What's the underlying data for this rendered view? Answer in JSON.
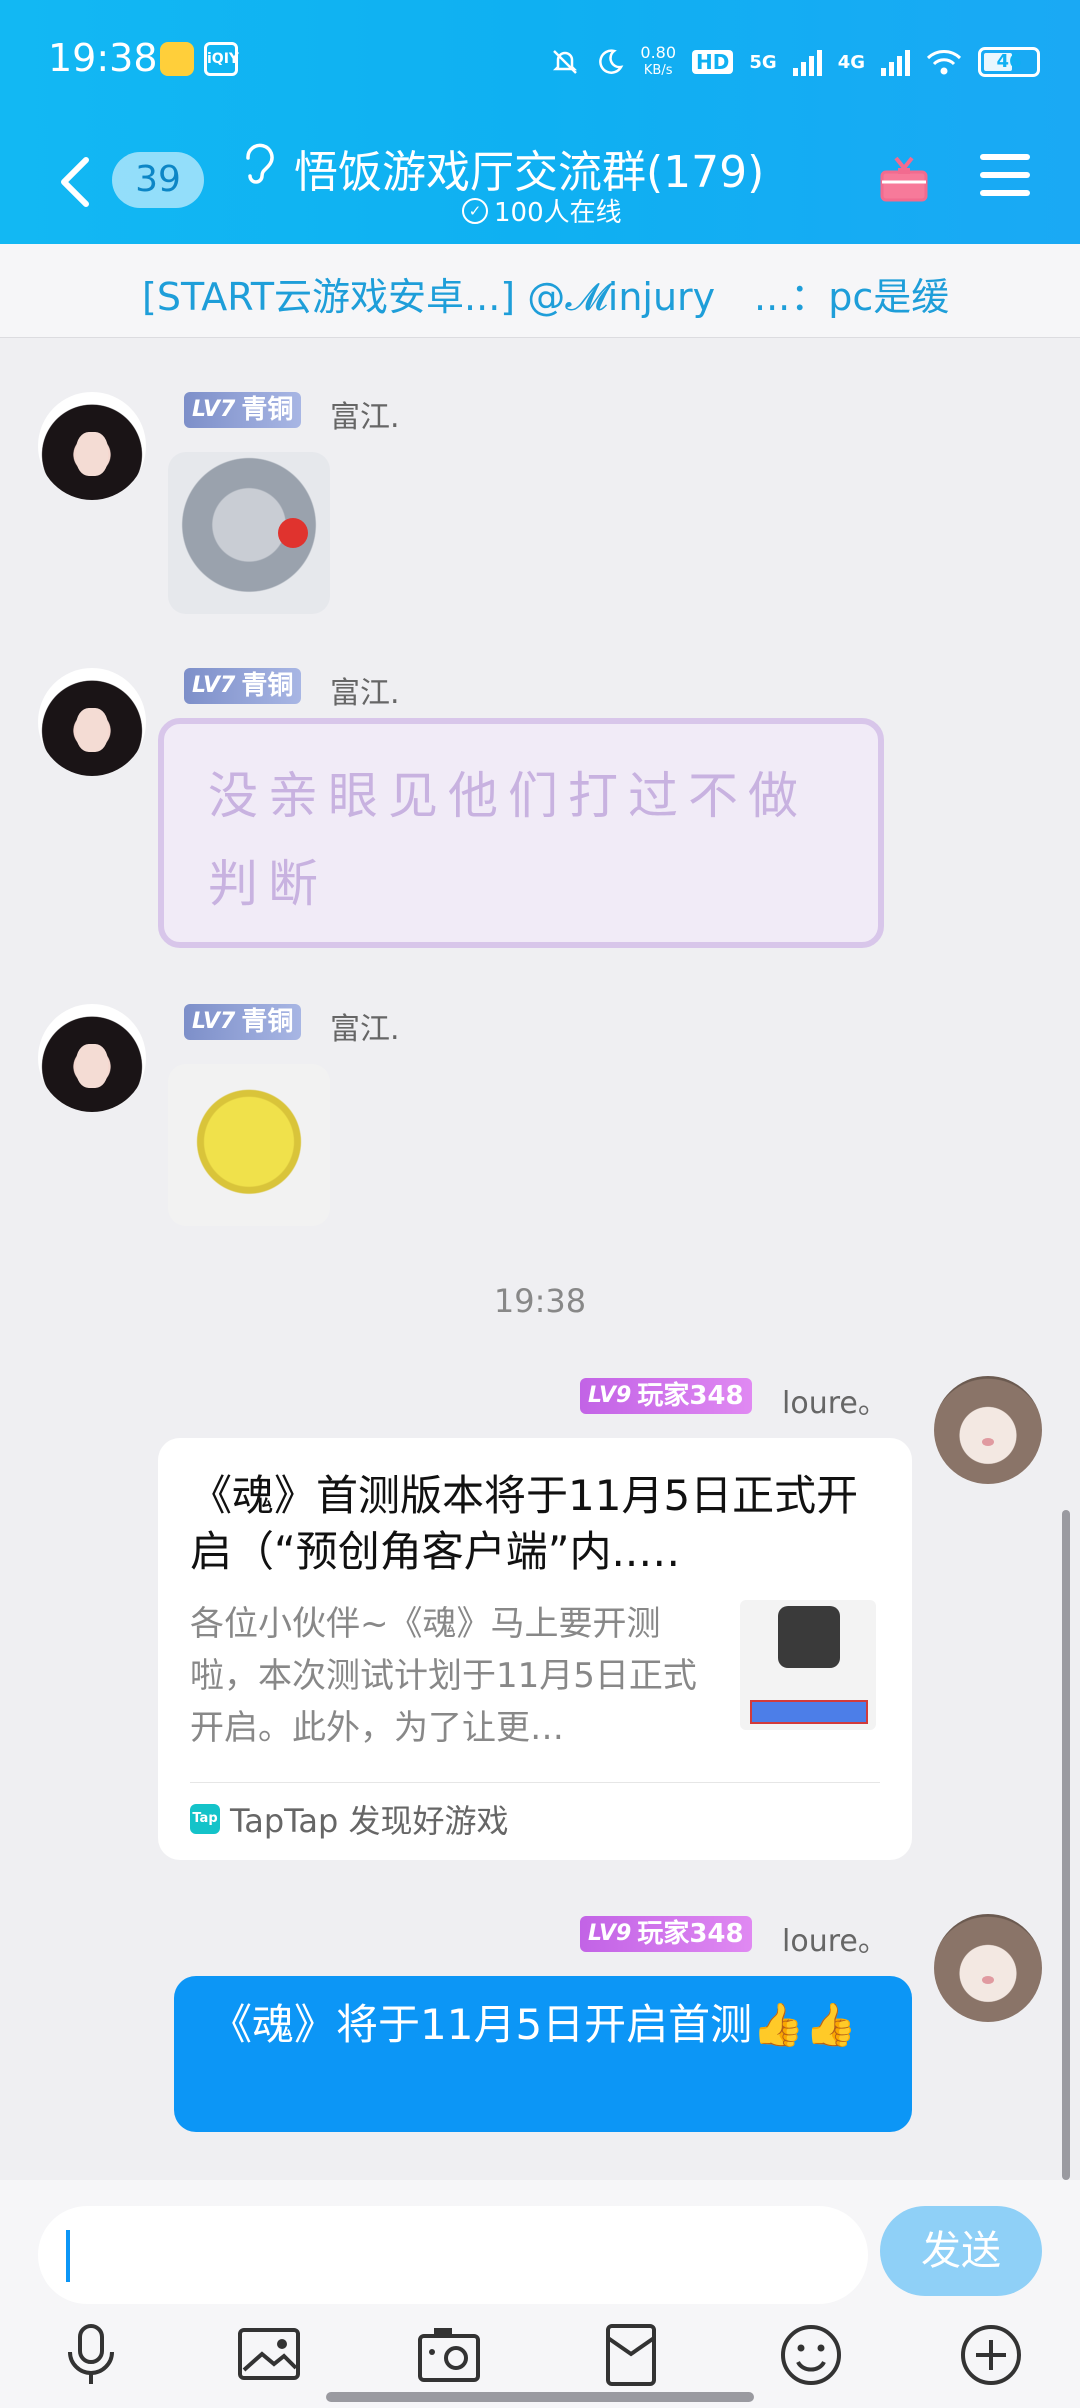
{
  "status_bar": {
    "time": "19:38",
    "net_speed_value": "0.80",
    "net_speed_unit": "KB/s",
    "hd_label": "HD",
    "net_5g": "5G",
    "net_4g": "4G",
    "battery": "46",
    "app_icon_2": "iQIY"
  },
  "header": {
    "back_count": "39",
    "group_title": "悟饭游戏厅交流群(179)",
    "online_text": "100人在线",
    "online_icon_glyph": "✓"
  },
  "notice": {
    "left": "[START云游戏安卓...] @𝓜injury",
    "right": "...：pc是缓"
  },
  "messages": {
    "msg1": {
      "level_tag": "LV7",
      "level_name": "青铜",
      "sender": "富江."
    },
    "msg2": {
      "level_tag": "LV7",
      "level_name": "青铜",
      "sender": "富江.",
      "sticker_text": "没亲眼见他们打过不做判断"
    },
    "msg3": {
      "level_tag": "LV7",
      "level_name": "青铜",
      "sender": "富江."
    },
    "time_separator": "19:38",
    "msg4": {
      "level_tag": "LV9",
      "level_name": "玩家348",
      "sender": "loure。",
      "card_title": "《魂》首测版本将于11月5日正式开启（“预创角客户端”内..…",
      "card_desc": "各位小伙伴~《魂》马上要开测啦，本次测试计划于11月5日正式开启。此外，为了让更…",
      "card_source_icon": "Tap",
      "card_source": "TapTap 发现好游戏"
    },
    "msg5": {
      "level_tag": "LV9",
      "level_name": "玩家348",
      "sender": "loure。",
      "text": "《魂》将于11月5日开启首测👍👍"
    }
  },
  "input": {
    "placeholder": "",
    "send_label": "发送"
  },
  "toolbar": [
    "mic-icon",
    "image-icon",
    "camera-icon",
    "red-packet-icon",
    "emoji-icon",
    "plus-icon"
  ],
  "colors": {
    "header_bg": "#12b8f3",
    "bubble_bg": "#0c96f6",
    "send_btn": "#8fd0f7",
    "notice_text": "#1e9ed9"
  }
}
